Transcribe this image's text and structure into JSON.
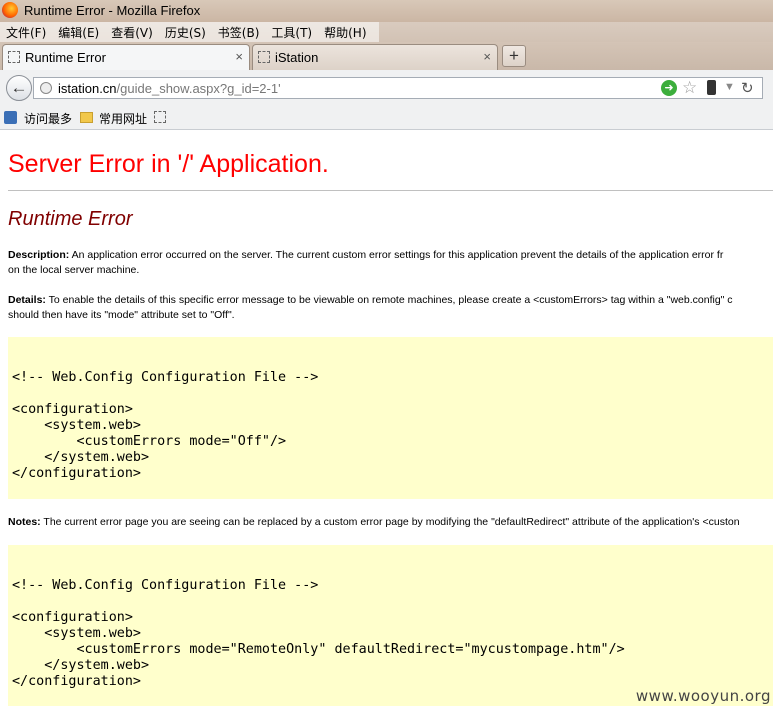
{
  "window": {
    "title": "Runtime Error - Mozilla Firefox"
  },
  "menu": [
    "文件(F)",
    "编辑(E)",
    "查看(V)",
    "历史(S)",
    "书签(B)",
    "工具(T)",
    "帮助(H)"
  ],
  "tabs": [
    {
      "label": "Runtime Error",
      "close": "×"
    },
    {
      "label": "iStation",
      "close": "×"
    }
  ],
  "newtab_label": "+",
  "nav": {
    "url_host": "istation.cn",
    "url_path": "/guide_show.aspx?g_id=2-1'"
  },
  "bookmarks": [
    "访问最多",
    "常用网址"
  ],
  "page": {
    "heading": "Server Error in '/' Application.",
    "subheading": "Runtime Error",
    "description_label": "Description:",
    "description_line1": " An application error occurred on the server. The current custom error settings for this application prevent the details of the application error fr",
    "description_line2": "on the local server machine.",
    "details_label": "Details:",
    "details_line1": " To enable the details of this specific error message to be viewable on remote machines, please create a <customErrors> tag within a \"web.config\" c",
    "details_line2": "should then have its \"mode\" attribute set to \"Off\".",
    "code1": "\n<!-- Web.Config Configuration File -->\n\n<configuration>\n    <system.web>\n        <customErrors mode=\"Off\"/>\n    </system.web>\n</configuration>",
    "notes_label": "Notes:",
    "notes_line1": " The current error page you are seeing can be replaced by a custom error page by modifying the \"defaultRedirect\" attribute of the application's <custon",
    "code2": "\n<!-- Web.Config Configuration File -->\n\n<configuration>\n    <system.web>\n        <customErrors mode=\"RemoteOnly\" defaultRedirect=\"mycustompage.htm\"/>\n    </system.web>\n</configuration>"
  },
  "watermark": "www.wooyun.org",
  "icons": {
    "back": "back-arrow-icon",
    "star": "star-icon",
    "reload": "reload-icon"
  },
  "colors": {
    "heading": "#ff0000",
    "subheading": "#800000",
    "codebox": "#ffffcc"
  }
}
